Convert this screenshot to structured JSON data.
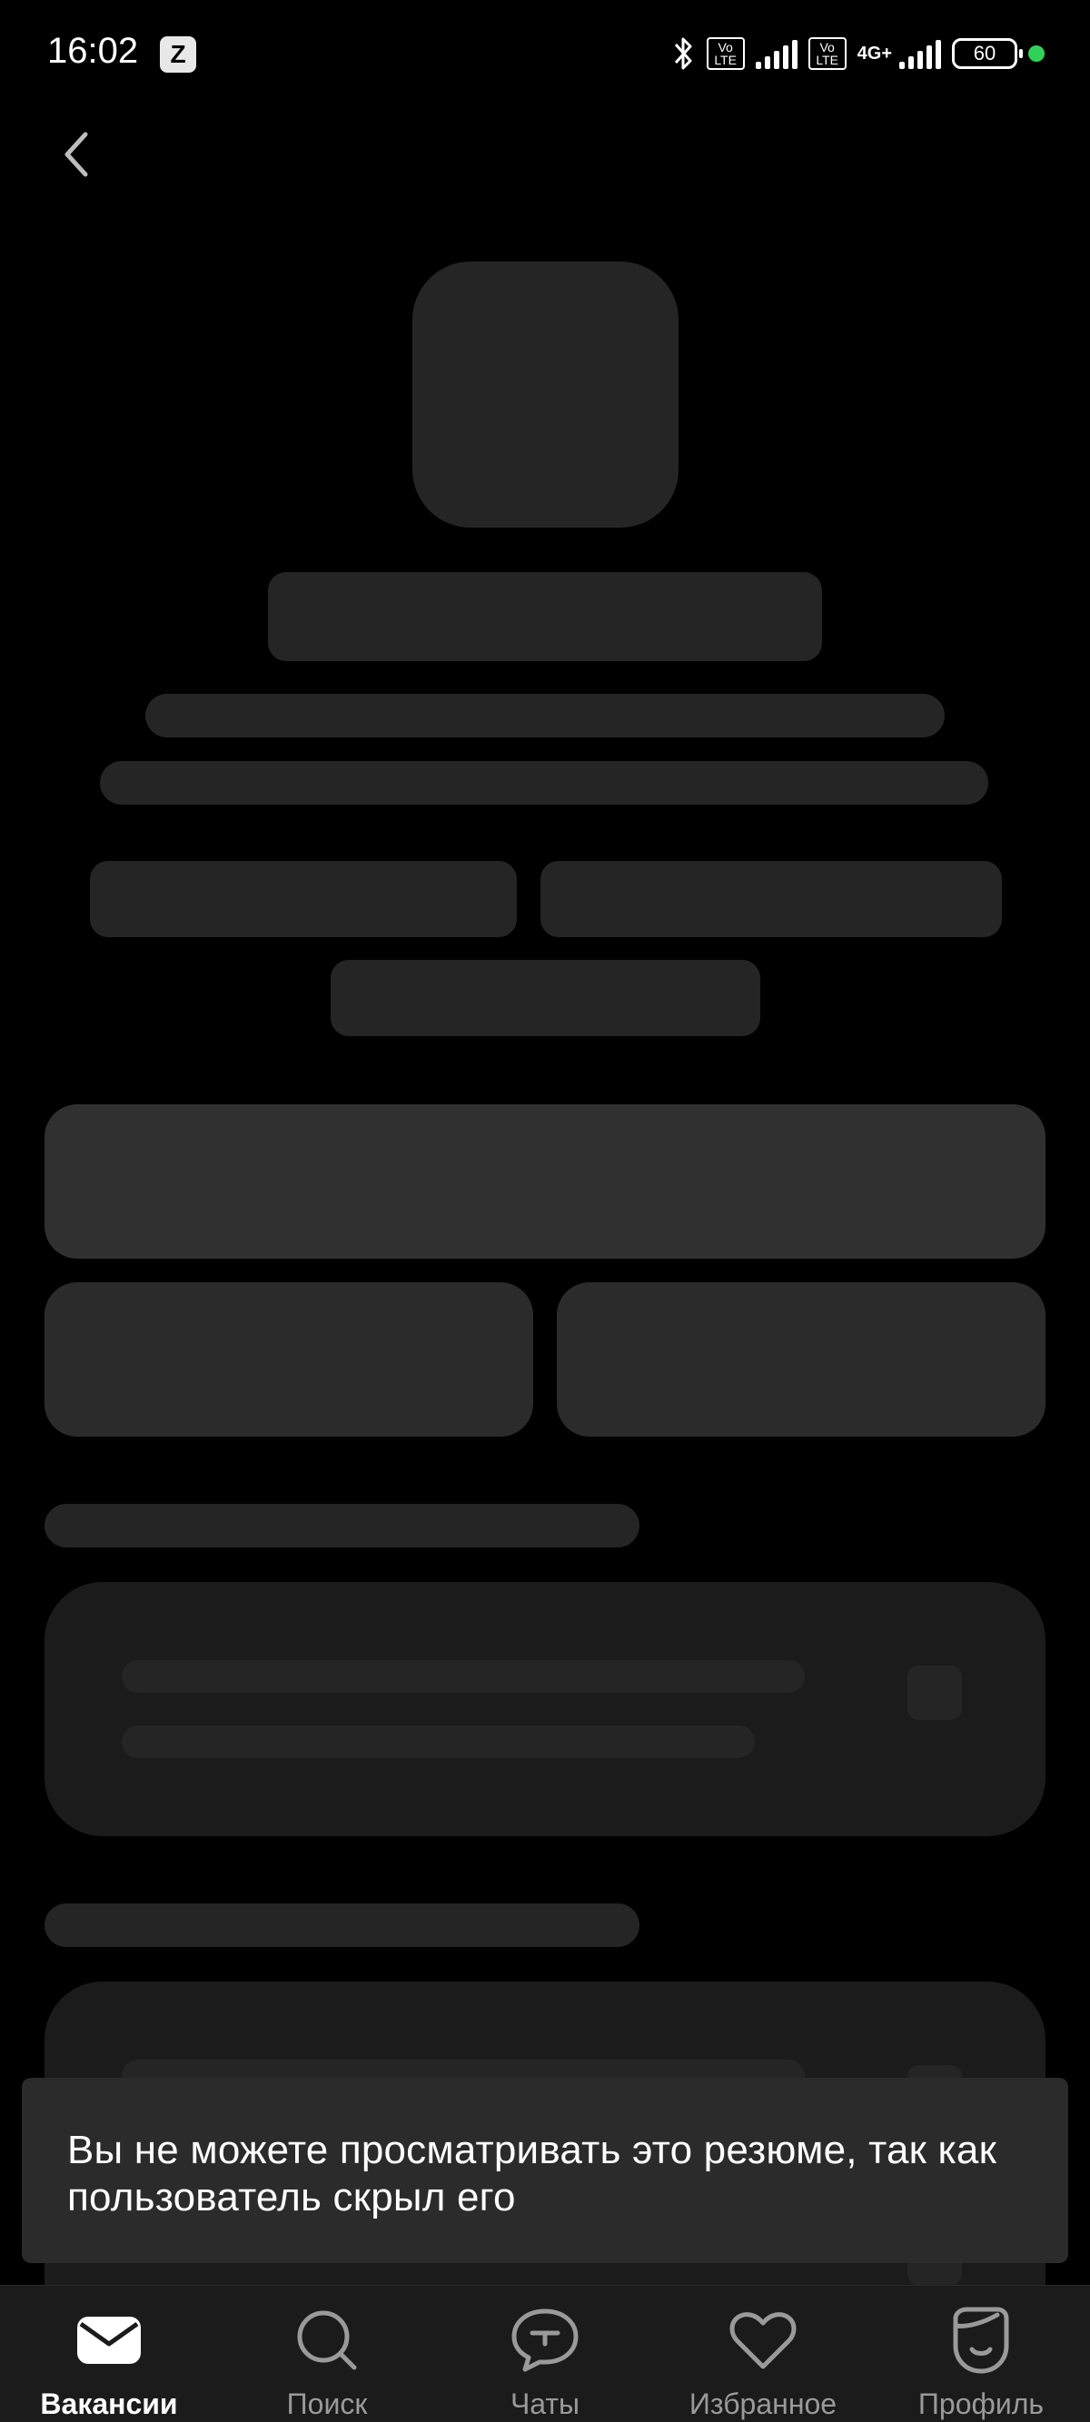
{
  "status_bar": {
    "time": "16:02",
    "app_icon": "Z",
    "volte1": "Vo LTE",
    "volte2": "Vo LTE",
    "network": "4G+",
    "battery": "60",
    "dot_color": "#31d158"
  },
  "toast": {
    "message": "Вы не можете просматривать это резюме, так как пользователь скрыл его"
  },
  "nav": {
    "items": [
      {
        "label": "Вакансии",
        "icon": "mail-icon",
        "active": true
      },
      {
        "label": "Поиск",
        "icon": "search-icon",
        "active": false
      },
      {
        "label": "Чаты",
        "icon": "chat-icon",
        "active": false
      },
      {
        "label": "Избранное",
        "icon": "heart-icon",
        "active": false
      },
      {
        "label": "Профиль",
        "icon": "profile-icon",
        "active": false
      }
    ]
  }
}
